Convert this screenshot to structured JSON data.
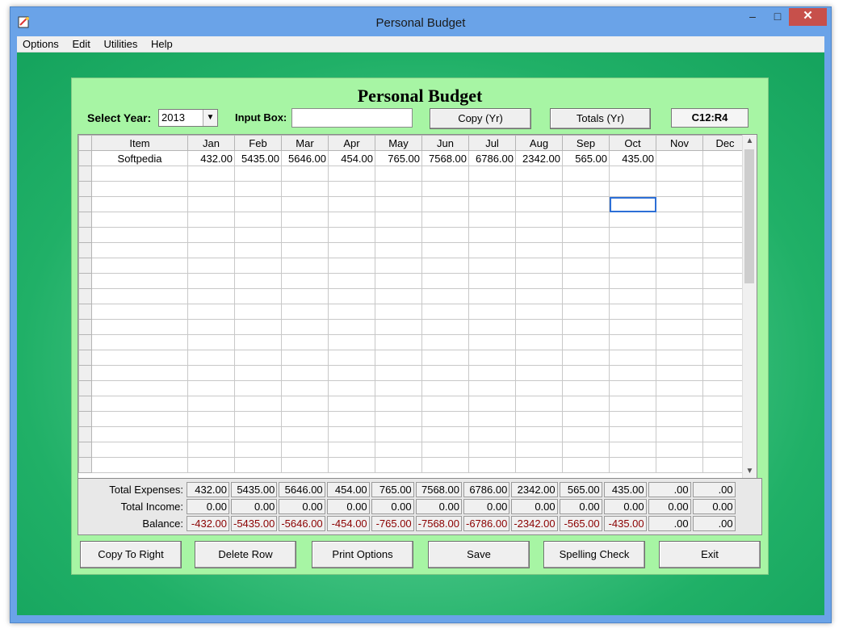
{
  "window": {
    "title": "Personal Budget"
  },
  "menu": [
    "Options",
    "Edit",
    "Utilities",
    "Help"
  ],
  "panel": {
    "title": "Personal Budget",
    "year_label": "Select Year:",
    "year_value": "2013",
    "input_label": "Input Box:",
    "input_value": "",
    "copy_button": "Copy (Yr)",
    "totals_button": "Totals (Yr)",
    "cell_ref": "C12:R4"
  },
  "grid": {
    "headers": [
      "Item",
      "Jan",
      "Feb",
      "Mar",
      "Apr",
      "May",
      "Jun",
      "Jul",
      "Aug",
      "Sep",
      "Oct",
      "Nov",
      "Dec"
    ],
    "rows": [
      [
        "Softpedia",
        "432.00",
        "5435.00",
        "5646.00",
        "454.00",
        "765.00",
        "7568.00",
        "6786.00",
        "2342.00",
        "565.00",
        "435.00",
        "",
        ""
      ]
    ],
    "visible_row_count": 21
  },
  "totals": {
    "expenses_label": "Total Expenses:",
    "income_label": "Total Income:",
    "balance_label": "Balance:",
    "expenses": [
      "432.00",
      "5435.00",
      "5646.00",
      "454.00",
      "765.00",
      "7568.00",
      "6786.00",
      "2342.00",
      "565.00",
      "435.00",
      ".00",
      ".00"
    ],
    "income": [
      "0.00",
      "0.00",
      "0.00",
      "0.00",
      "0.00",
      "0.00",
      "0.00",
      "0.00",
      "0.00",
      "0.00",
      "0.00",
      "0.00"
    ],
    "balance": [
      "-432.00",
      "-5435.00",
      "-5646.00",
      "-454.00",
      "-765.00",
      "-7568.00",
      "-6786.00",
      "-2342.00",
      "-565.00",
      "-435.00",
      ".00",
      ".00"
    ]
  },
  "buttons": {
    "copy_to_right": "Copy To Right",
    "delete_row": "Delete Row",
    "print_options": "Print Options",
    "save": "Save",
    "spelling_check": "Spelling Check",
    "exit": "Exit"
  },
  "colors": {
    "titlebar": "#6aa3e8",
    "panel": "#a7f5a4",
    "background_green": "#20b067",
    "negative": "#8b0000"
  }
}
